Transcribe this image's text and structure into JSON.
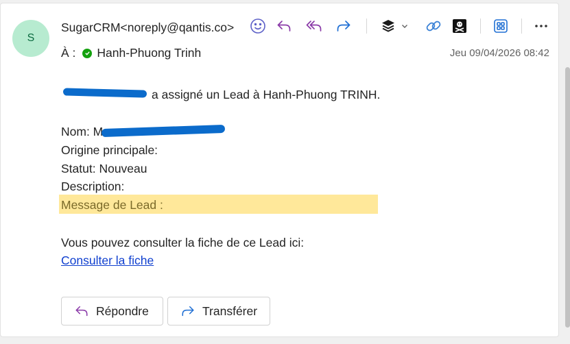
{
  "header": {
    "avatar_initial": "S",
    "from": "SugarCRM<noreply@qantis.co>",
    "to_label": "À :",
    "to_name": "Hanh-Phuong Trinh",
    "date": "Jeu 09/04/2026 08:42"
  },
  "toolbar": {
    "icons": [
      "emoji-icon",
      "reply-icon",
      "reply-all-icon",
      "forward-icon",
      "layers-icon",
      "chevron-down-icon",
      "link-icon",
      "pirate-icon",
      "apps-icon",
      "more-icon"
    ]
  },
  "body": {
    "line1_visible": "a assigné un Lead à Hanh-Phuong TRINH.",
    "name_label": "Nom: M",
    "origin": "Origine principale:",
    "status": "Statut: Nouveau",
    "description": "Description:",
    "message_lead": "Message de Lead :",
    "consult_text": "Vous pouvez consulter la fiche de ce Lead ici:",
    "consult_link": "Consulter la fiche"
  },
  "actions": {
    "reply": "Répondre",
    "forward": "Transférer"
  },
  "colors": {
    "accent": "#5b5fc7",
    "avatar_bg": "#b7ebd0",
    "highlight": "#ffe89a",
    "redaction": "#0b6bcb",
    "link": "#0f3fcf"
  }
}
